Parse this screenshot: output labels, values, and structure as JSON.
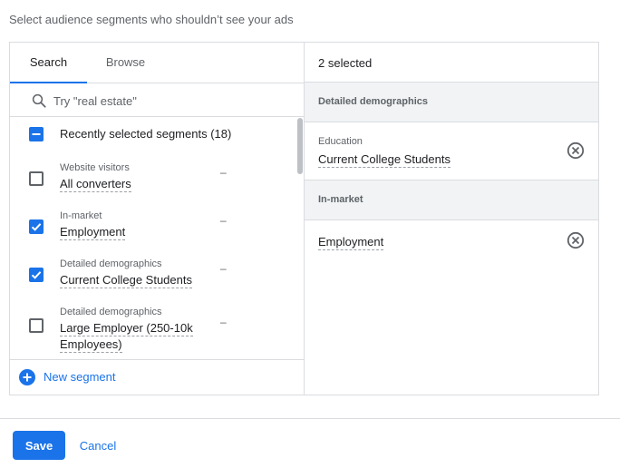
{
  "instruction": "Select audience segments who shouldn’t see your ads",
  "tabs": [
    {
      "label": "Search",
      "active": true
    },
    {
      "label": "Browse",
      "active": false
    }
  ],
  "search": {
    "placeholder": "Try \"real estate\"",
    "value": "",
    "icon": "search-icon"
  },
  "list": {
    "recent": {
      "label": "Recently selected segments (18)",
      "state": "indeterminate"
    },
    "items": [
      {
        "category": "Website visitors",
        "name": "All converters",
        "checked": false,
        "extra": "–"
      },
      {
        "category": "In-market",
        "name": "Employment",
        "checked": true,
        "extra": "–"
      },
      {
        "category": "Detailed demographics",
        "name": "Current College Students",
        "checked": true,
        "extra": "–"
      },
      {
        "category": "Detailed demographics",
        "name_line1": "Large Employer (250-10k",
        "name_line2": "Employees)",
        "checked": false,
        "extra": "–"
      }
    ],
    "new_segment": {
      "label": "New segment",
      "icon": "plus-circle-icon"
    }
  },
  "selected": {
    "count_label": "2 selected",
    "groups": [
      {
        "title": "Detailed demographics",
        "items": [
          {
            "category": "Education",
            "name": "Current College Students"
          }
        ]
      },
      {
        "title": "In-market",
        "items": [
          {
            "category": "",
            "name": "Employment"
          }
        ]
      }
    ]
  },
  "footer": {
    "save_label": "Save",
    "cancel_label": "Cancel"
  },
  "colors": {
    "accent": "#1a73e8",
    "border": "#dadce0",
    "group_bg": "#f1f3f4"
  }
}
